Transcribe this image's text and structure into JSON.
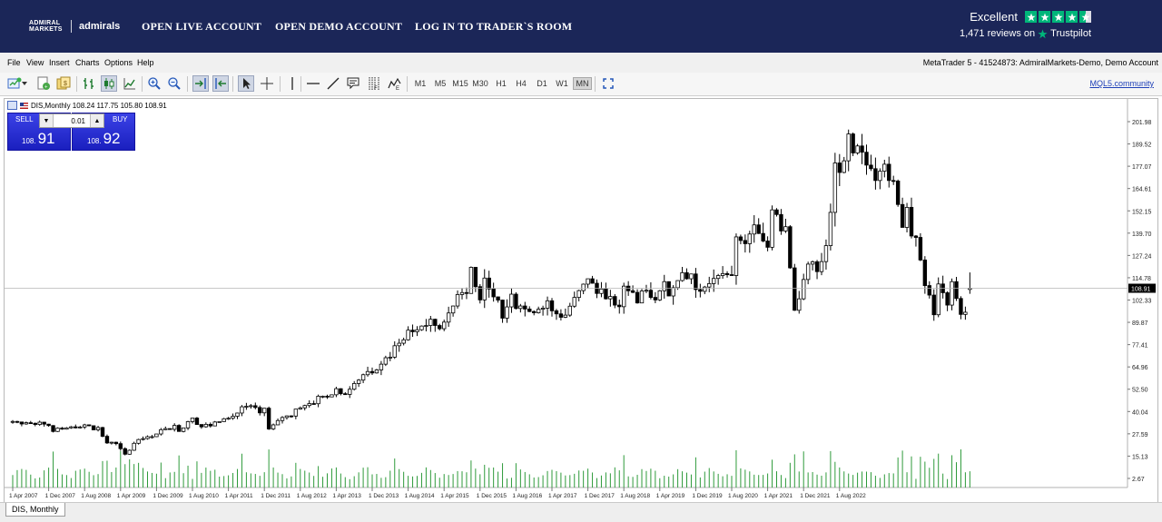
{
  "banner": {
    "brand_mark_line1": "ADMIRAL",
    "brand_mark_line2": "MARKETS",
    "brand_name": "admirals",
    "nav": [
      "OPEN LIVE ACCOUNT",
      "OPEN DEMO ACCOUNT",
      "LOG IN TO TRADER`S ROOM"
    ],
    "trustpilot": {
      "rating_text": "Excellent",
      "stars": 4.5,
      "reviews_text": "1,471 reviews on",
      "brand": "Trustpilot",
      "color": "#00b67a"
    }
  },
  "menu": {
    "items": [
      "File",
      "View",
      "Insert",
      "Charts",
      "Options",
      "Help"
    ],
    "account": "MetaTrader 5 - 41524873: AdmiralMarkets-Demo, Demo Account"
  },
  "toolbar": {
    "timeframes": [
      "M1",
      "M5",
      "M15",
      "M30",
      "H1",
      "H4",
      "D1",
      "W1",
      "MN"
    ],
    "active_timeframe": "MN",
    "mql_link": "MQL5.community",
    "icons": [
      "new-chart-icon",
      "dropdown-arrow-icon",
      "new-order-icon",
      "strategy-tester-icon",
      "bar-chart-icon",
      "candlestick-chart-icon",
      "line-chart-icon",
      "zoom-in-icon",
      "zoom-out-icon",
      "chart-shift-icon",
      "autoscroll-icon",
      "cursor-icon",
      "crosshair-icon",
      "vertical-line-icon",
      "horizontal-line-icon",
      "trendline-icon",
      "text-label-icon",
      "fibonacci-icon",
      "elliott-wave-icon",
      "fullscreen-icon"
    ]
  },
  "chart": {
    "header": "DIS,Monthly  108.24 117.75 105.80 108.91",
    "tab_label": "DIS, Monthly",
    "price_label": "108.91",
    "trade_panel": {
      "sell_label": "SELL",
      "buy_label": "BUY",
      "lot": "0.01",
      "sell_small": "108.",
      "sell_big": "91",
      "buy_small": "108.",
      "buy_big": "92"
    }
  },
  "chart_data": {
    "type": "candlestick",
    "symbol": "DIS",
    "timeframe": "Monthly",
    "last": {
      "open": 108.24,
      "high": 117.75,
      "low": 105.8,
      "close": 108.91
    },
    "ylim": [
      0,
      208
    ],
    "y_ticks": [
      "201.98",
      "189.52",
      "177.07",
      "164.61",
      "152.15",
      "139.70",
      "127.24",
      "114.78",
      "102.33",
      "89.87",
      "77.41",
      "64.96",
      "52.50",
      "40.04",
      "27.59",
      "15.13",
      "2.67"
    ],
    "x_ticks": [
      "1 Apr 2007",
      "1 Dec 2007",
      "1 Aug 2008",
      "1 Apr 2009",
      "1 Dec 2009",
      "1 Aug 2010",
      "1 Apr 2011",
      "1 Dec 2011",
      "1 Aug 2012",
      "1 Apr 2013",
      "1 Dec 2013",
      "1 Aug 2014",
      "1 Apr 2015",
      "1 Dec 2015",
      "1 Aug 2016",
      "1 Apr 2017",
      "1 Dec 2017",
      "1 Aug 2018",
      "1 Apr 2019",
      "1 Dec 2019",
      "1 Aug 2020",
      "1 Apr 2021",
      "1 Dec 2021",
      "1 Aug 2022"
    ],
    "start": "2007-03",
    "closes": [
      34.5,
      34.2,
      33.1,
      33.8,
      33.5,
      32.8,
      34.1,
      33.0,
      32.2,
      28.9,
      30.8,
      30.2,
      30.9,
      31.5,
      30.9,
      31.4,
      32.6,
      32.1,
      29.8,
      31.1,
      26.2,
      22.5,
      22.9,
      22.1,
      19.3,
      16.2,
      18.4,
      22.3,
      24.4,
      24.9,
      26.0,
      26.0,
      27.5,
      29.9,
      30.5,
      30.1,
      32.3,
      28.9,
      30.9,
      34.4,
      36.4,
      32.8,
      31.5,
      32.9,
      32.0,
      34.2,
      34.4,
      36.0,
      36.3,
      37.4,
      39.2,
      42.7,
      43.0,
      43.3,
      42.3,
      39.3,
      41.9,
      30.3,
      32.6,
      35.0,
      36.7,
      37.6,
      37.5,
      41.4,
      42.1,
      43.4,
      44.5,
      44.4,
      48.6,
      48.6,
      48.2,
      49.4,
      52.8,
      50.0,
      49.6,
      52.5,
      55.7,
      57.6,
      60.6,
      62.4,
      61.6,
      63.3,
      66.5,
      70.1,
      70.4,
      76.8,
      78.2,
      80.1,
      85.5,
      84.6,
      85.7,
      87.8,
      88.1,
      91.6,
      88.1,
      86.3,
      90.0,
      95.1,
      99.0,
      105.4,
      106.5,
      106.0,
      120.6,
      109.8,
      102.4,
      114.6,
      108.5,
      104.1,
      102.3,
      92.2,
      98.5,
      105.6,
      97.6,
      99.0,
      97.3,
      95.9,
      95.2,
      97.2,
      97.8,
      101.9,
      96.3,
      94.6,
      92.7,
      93.9,
      98.9,
      103.8,
      107.6,
      111.2,
      114.2,
      111.7,
      106.0,
      108.5,
      103.0,
      104.3,
      99.5,
      98.6,
      110.1,
      107.5,
      106.6,
      100.7,
      107.4,
      107.8,
      103.8,
      102.4,
      107.5,
      112.6,
      104.6,
      109.2,
      113.2,
      117.6,
      114.2,
      116.9,
      108.2,
      107.2,
      109.6,
      111.5,
      114.4,
      116.0,
      117.1,
      116.5,
      116.0,
      137.6,
      135.6,
      133.8,
      139.2,
      144.3,
      139.5,
      135.3,
      131.8,
      152.7,
      150.1,
      140.9,
      143.3,
      120.3,
      96.6,
      103.0,
      113.8,
      122.4,
      123.7,
      118.2,
      123.8,
      132.7,
      151.3,
      178.9,
      173.6,
      180.1,
      195.1,
      184.5,
      188.4,
      184.9,
      177.7,
      175.7,
      169.1,
      174.3,
      178.2,
      169.1,
      168.8,
      155.7,
      142.9,
      154.1,
      138.1,
      137.3,
      124.7,
      110.4,
      105.1,
      94.1,
      111.3,
      106.4,
      99.5,
      112.6,
      103.2,
      94.3,
      95.5,
      108.91
    ],
    "volume_hint": "relative monthly volume bars shown in green below candles"
  }
}
